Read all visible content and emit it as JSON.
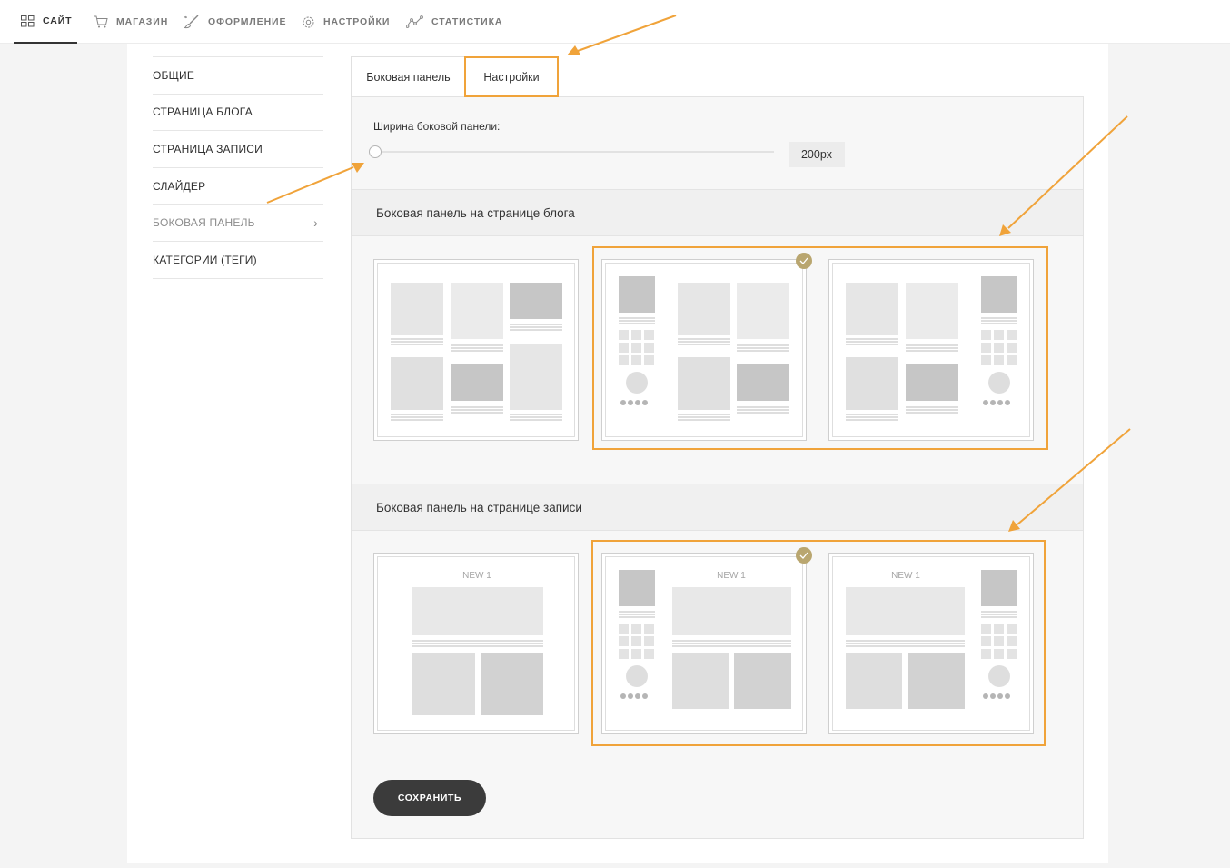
{
  "topnav": {
    "items": [
      {
        "label": "САЙТ",
        "icon": "grid-icon"
      },
      {
        "label": "МАГАЗИН",
        "icon": "cart-icon"
      },
      {
        "label": "ОФОРМЛЕНИЕ",
        "icon": "brush-icon"
      },
      {
        "label": "НАСТРОЙКИ",
        "icon": "gear-icon"
      },
      {
        "label": "СТАТИСТИКА",
        "icon": "chart-line-icon"
      }
    ],
    "active_index": 0
  },
  "leftmenu": {
    "items": [
      {
        "label": "ОБЩИЕ"
      },
      {
        "label": "СТРАНИЦА БЛОГА"
      },
      {
        "label": "СТРАНИЦА ЗАПИСИ"
      },
      {
        "label": "СЛАЙДЕР"
      },
      {
        "label": "БОКОВАЯ ПАНЕЛЬ",
        "chevron": "›"
      },
      {
        "label": "КАТЕГОРИИ (ТЕГИ)"
      }
    ],
    "active_index": 4
  },
  "tabs": [
    {
      "label": "Боковая панель"
    },
    {
      "label": "Настройки"
    }
  ],
  "active_tab_index": 1,
  "settings": {
    "width_label": "Ширина боковой панели:",
    "width_value": "200px",
    "width_slider_fraction": 0
  },
  "blog_section": {
    "title": "Боковая панель на странице блога",
    "options": [
      "no-sidebar",
      "sidebar-left",
      "sidebar-right"
    ],
    "selected_index": 1
  },
  "post_section": {
    "title": "Боковая панель на странице записи",
    "thumb_heading": "NEW 1",
    "options": [
      "no-sidebar",
      "sidebar-left",
      "sidebar-right"
    ],
    "selected_index": 1
  },
  "save_button": {
    "label": "СОХРАНИТЬ"
  },
  "colors": {
    "highlight": "#f0a33a",
    "check": "#b9a66f",
    "button_bg": "#3b3b3b"
  }
}
